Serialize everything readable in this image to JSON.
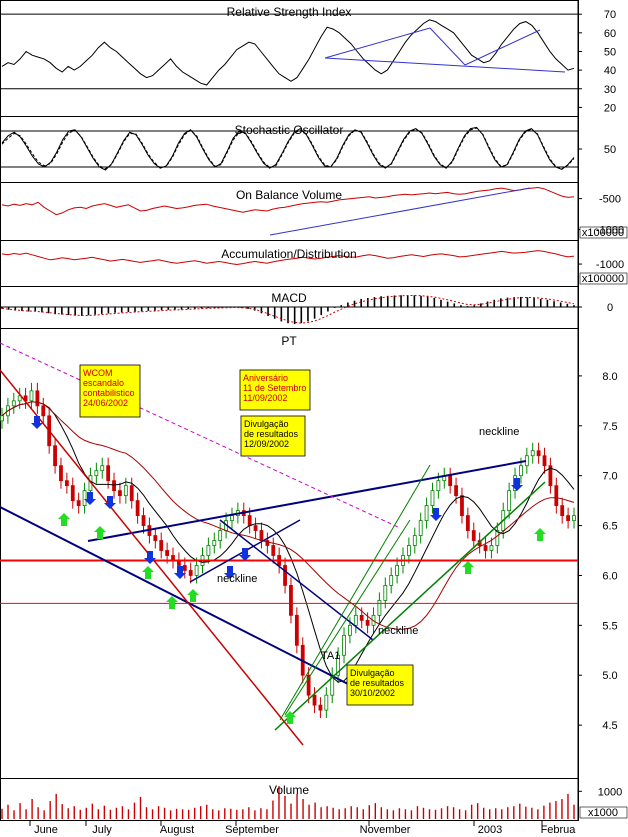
{
  "chart_data": [
    {
      "type": "line",
      "title": "Relative Strength Index",
      "y_ticks": [
        "70",
        "60",
        "50",
        "40",
        "30",
        "20"
      ],
      "ylim": [
        17,
        76
      ],
      "reference_levels": [
        70,
        30
      ],
      "series": [
        {
          "values": [
            42,
            44,
            43,
            46,
            50,
            48,
            47,
            46,
            44,
            41,
            39,
            42,
            40,
            42,
            45,
            48,
            52,
            55,
            52,
            50,
            47,
            44,
            41,
            38,
            36,
            37,
            40,
            43,
            46,
            42,
            39,
            37,
            35,
            33,
            32,
            36,
            40,
            43,
            47,
            51,
            53,
            55,
            54,
            50,
            46,
            42,
            38,
            36,
            34,
            36,
            41,
            46,
            52,
            58,
            63,
            62,
            60,
            57,
            54,
            50,
            46,
            43,
            40,
            38,
            40,
            45,
            50,
            55,
            59,
            62,
            65,
            67,
            66,
            64,
            62,
            60,
            56,
            52,
            48,
            46,
            44,
            45,
            49,
            54,
            58,
            62,
            65,
            66,
            64,
            60,
            55,
            50,
            46,
            43,
            40,
            41
          ]
        }
      ]
    },
    {
      "type": "line",
      "title": "Stochastic Oscillator",
      "y_ticks": [
        "50"
      ],
      "ylim": [
        0,
        100
      ],
      "reference_levels": [
        80,
        20
      ],
      "series": [
        {
          "values": [
            60,
            72,
            78,
            70,
            55,
            38,
            25,
            20,
            28,
            45,
            66,
            80,
            82,
            70,
            52,
            34,
            20,
            15,
            25,
            44,
            64,
            78,
            74,
            58,
            40,
            26,
            18,
            22,
            38,
            60,
            76,
            82,
            70,
            50,
            32,
            20,
            26,
            46,
            68,
            80,
            76,
            60,
            42,
            26,
            18,
            24,
            42,
            62,
            78,
            84,
            74,
            56,
            36,
            22,
            20,
            34,
            56,
            74,
            82,
            78,
            60,
            40,
            24,
            18,
            26,
            46,
            66,
            80,
            84,
            76,
            58,
            38,
            24,
            18,
            30,
            52,
            72,
            84,
            86,
            74,
            52,
            32,
            20,
            24,
            44,
            66,
            80,
            84,
            74,
            52,
            32,
            20,
            16,
            24,
            36
          ]
        },
        {
          "values": [
            58,
            68,
            76,
            72,
            58,
            42,
            28,
            22,
            26,
            42,
            62,
            77,
            81,
            71,
            54,
            36,
            22,
            17,
            24,
            42,
            62,
            76,
            75,
            60,
            42,
            28,
            19,
            21,
            36,
            57,
            74,
            81,
            72,
            52,
            34,
            21,
            24,
            44,
            65,
            78,
            77,
            62,
            44,
            28,
            19,
            22,
            40,
            60,
            76,
            82,
            75,
            58,
            38,
            24,
            20,
            32,
            54,
            72,
            81,
            79,
            62,
            42,
            26,
            19,
            25,
            44,
            64,
            78,
            83,
            77,
            60,
            40,
            25,
            19,
            28,
            50,
            70,
            82,
            85,
            75,
            54,
            34,
            21,
            23,
            42,
            64,
            78,
            83,
            75,
            54,
            34,
            21,
            17,
            23,
            34
          ]
        }
      ]
    },
    {
      "type": "line",
      "title": "On Balance Volume",
      "y_ticks": [
        "-500",
        "-1000"
      ],
      "axis_multiplier": "x100000",
      "ylim": [
        -1120,
        -280
      ],
      "series": [
        {
          "values": [
            -600,
            -620,
            -590,
            -610,
            -580,
            -600,
            -560,
            -640,
            -700,
            -760,
            -730,
            -680,
            -650,
            -640,
            -660,
            -620,
            -600,
            -580,
            -610,
            -640,
            -620,
            -600,
            -650,
            -700,
            -690,
            -660,
            -640,
            -620,
            -640,
            -660,
            -650,
            -630,
            -610,
            -600,
            -590,
            -620,
            -640,
            -660,
            -680,
            -700,
            -720,
            -700,
            -680,
            -690,
            -700,
            -670,
            -650,
            -640,
            -620,
            -600,
            -580,
            -570,
            -560,
            -550,
            -560,
            -540,
            -520,
            -510,
            -500,
            -490,
            -480,
            -470,
            -490,
            -480,
            -470,
            -450,
            -440,
            -430,
            -440,
            -430,
            -420,
            -410,
            -420,
            -410,
            -400,
            -420,
            -430,
            -420,
            -400,
            -380,
            -370,
            -360,
            -340,
            -330,
            -350,
            -370,
            -360,
            -340,
            -330,
            -320,
            -340,
            -380,
            -420,
            -460,
            -480,
            -470
          ]
        }
      ]
    },
    {
      "type": "line",
      "title": "Accumulation/Distribution",
      "y_ticks": [
        "-1000"
      ],
      "axis_multiplier": "x100000",
      "ylim": [
        -1450,
        -500
      ],
      "series": [
        {
          "values": [
            -760,
            -780,
            -750,
            -770,
            -740,
            -780,
            -820,
            -860,
            -900,
            -880,
            -850,
            -870,
            -900,
            -880,
            -860,
            -840,
            -870,
            -900,
            -930,
            -910,
            -890,
            -910,
            -940,
            -960,
            -940,
            -920,
            -900,
            -930,
            -960,
            -980,
            -960,
            -940,
            -920,
            -950,
            -980,
            -960,
            -940,
            -960,
            -990,
            -1010,
            -990,
            -960,
            -940,
            -960,
            -980,
            -950,
            -920,
            -900,
            -880,
            -860,
            -840,
            -860,
            -880,
            -860,
            -840,
            -820,
            -800,
            -820,
            -840,
            -830,
            -800,
            -780,
            -800,
            -830,
            -860,
            -850,
            -820,
            -800,
            -780,
            -800,
            -820,
            -790,
            -770,
            -760,
            -780,
            -800,
            -830,
            -820,
            -800,
            -780,
            -760,
            -740,
            -720,
            -700,
            -720,
            -740,
            -730,
            -720,
            -700,
            -680,
            -700,
            -730,
            -760,
            -800,
            -830,
            -810
          ]
        }
      ]
    },
    {
      "type": "bar",
      "title": "MACD",
      "y_ticks": [
        "0"
      ],
      "ylim": [
        -1,
        1
      ],
      "series": [
        {
          "values": [
            -0.1,
            -0.15,
            -0.2,
            -0.22,
            -0.25,
            -0.24,
            -0.3,
            -0.35,
            -0.4,
            -0.42,
            -0.45,
            -0.48,
            -0.5,
            -0.46,
            -0.42,
            -0.38,
            -0.36,
            -0.32,
            -0.3,
            -0.28,
            -0.26,
            -0.24,
            -0.22,
            -0.2,
            -0.18,
            -0.16,
            -0.15,
            -0.14,
            -0.12,
            -0.1,
            -0.08,
            -0.06,
            -0.05,
            -0.04,
            -0.03,
            -0.02,
            -0.05,
            -0.1,
            -0.2,
            -0.35,
            -0.5,
            -0.65,
            -0.8,
            -0.9,
            -0.95,
            -0.9,
            -0.8,
            -0.65,
            -0.45,
            -0.25,
            -0.05,
            0.1,
            0.25,
            0.35,
            0.45,
            0.5,
            0.55,
            0.6,
            0.62,
            0.64,
            0.65,
            0.66,
            0.65,
            0.62,
            0.58,
            0.5,
            0.4,
            0.3,
            0.2,
            0.1,
            0.05,
            0.1,
            0.2,
            0.3,
            0.4,
            0.48,
            0.52,
            0.55,
            0.56,
            0.54,
            0.5,
            0.45,
            0.4,
            0.32,
            0.25,
            0.18,
            0.1
          ]
        },
        {
          "values": [
            -0.08,
            -0.12,
            -0.16,
            -0.2,
            -0.22,
            -0.24,
            -0.27,
            -0.31,
            -0.35,
            -0.39,
            -0.42,
            -0.45,
            -0.47,
            -0.47,
            -0.45,
            -0.42,
            -0.39,
            -0.36,
            -0.33,
            -0.31,
            -0.28,
            -0.26,
            -0.24,
            -0.22,
            -0.2,
            -0.18,
            -0.16,
            -0.15,
            -0.13,
            -0.11,
            -0.09,
            -0.07,
            -0.06,
            -0.05,
            -0.04,
            -0.03,
            -0.04,
            -0.07,
            -0.13,
            -0.24,
            -0.37,
            -0.51,
            -0.65,
            -0.77,
            -0.86,
            -0.89,
            -0.86,
            -0.78,
            -0.64,
            -0.47,
            -0.29,
            -0.12,
            0.04,
            0.17,
            0.29,
            0.38,
            0.45,
            0.51,
            0.56,
            0.59,
            0.62,
            0.64,
            0.64,
            0.63,
            0.6,
            0.55,
            0.48,
            0.4,
            0.31,
            0.22,
            0.14,
            0.12,
            0.15,
            0.21,
            0.29,
            0.36,
            0.43,
            0.48,
            0.52,
            0.53,
            0.52,
            0.49,
            0.45,
            0.39,
            0.32,
            0.25,
            0.18
          ]
        }
      ]
    },
    {
      "type": "candlestick",
      "title": "PT",
      "y_ticks": [
        "8.0",
        "7.5",
        "7.0",
        "6.5",
        "6.0",
        "5.5",
        "5.0",
        "4.5"
      ],
      "ylim": [
        4.0,
        8.45
      ],
      "close": [
        7.6,
        7.7,
        7.75,
        7.8,
        7.75,
        7.85,
        7.7,
        7.6,
        7.3,
        7.1,
        6.95,
        6.9,
        6.75,
        6.7,
        6.85,
        7.0,
        7.05,
        7.1,
        6.95,
        6.85,
        6.8,
        6.9,
        6.75,
        6.6,
        6.5,
        6.4,
        6.35,
        6.25,
        6.2,
        6.15,
        6.1,
        6.05,
        6.0,
        6.1,
        6.2,
        6.3,
        6.35,
        6.45,
        6.55,
        6.6,
        6.65,
        6.6,
        6.5,
        6.45,
        6.35,
        6.3,
        6.2,
        6.1,
        5.9,
        5.6,
        5.3,
        5.0,
        4.8,
        4.7,
        4.65,
        4.8,
        5.0,
        5.2,
        5.4,
        5.5,
        5.6,
        5.55,
        5.5,
        5.6,
        5.75,
        5.9,
        6.0,
        6.1,
        6.2,
        6.3,
        6.4,
        6.55,
        6.7,
        6.85,
        6.95,
        7.0,
        6.9,
        6.8,
        6.6,
        6.45,
        6.35,
        6.3,
        6.25,
        6.3,
        6.45,
        6.65,
        6.85,
        7.0,
        7.1,
        7.2,
        7.25,
        7.2,
        7.1,
        6.9,
        6.7,
        6.6,
        6.55,
        6.6
      ],
      "annotations": [
        {
          "lines": [
            "WCOM",
            "escandalo",
            "contabilistico",
            "24/06/2002"
          ]
        },
        {
          "lines": [
            "Aniversário",
            "11 de Setembro",
            "11/09/2002"
          ]
        },
        {
          "lines": [
            "Divulgação",
            "de resultados",
            "12/09/2002"
          ]
        },
        {
          "lines": [
            "Divulgação",
            "de resultados",
            "30/10/2002"
          ]
        }
      ],
      "pattern_labels": [
        "neckline",
        "neckline",
        "neckline",
        "TA1"
      ]
    },
    {
      "type": "bar",
      "title": "Volume",
      "y_ticks": [
        "1000"
      ],
      "axis_multiplier": "x1000",
      "ylim": [
        0,
        1400
      ],
      "values": [
        320,
        480,
        260,
        540,
        300,
        700,
        380,
        260,
        620,
        900,
        500,
        340,
        420,
        280,
        360,
        520,
        300,
        440,
        280,
        360,
        420,
        300,
        560,
        780,
        380,
        300,
        420,
        360,
        260,
        320,
        300,
        280,
        360,
        420,
        480,
        300,
        260,
        340,
        320,
        280,
        300,
        380,
        260,
        340,
        300,
        640,
        1200,
        820,
        520,
        900,
        700,
        480,
        560,
        380,
        420,
        360,
        300,
        340,
        420,
        380,
        300,
        460,
        540,
        380,
        300,
        260,
        340,
        300,
        260,
        420,
        360,
        300,
        280,
        340,
        420,
        380,
        300,
        260,
        480,
        540,
        360,
        300,
        340,
        300,
        380,
        420,
        520,
        400,
        360,
        300,
        440,
        560,
        620,
        700,
        900,
        480
      ],
      "x_tick_labels": [
        "June",
        "July",
        "August",
        "September",
        "November",
        "2003",
        "Februa"
      ]
    }
  ]
}
